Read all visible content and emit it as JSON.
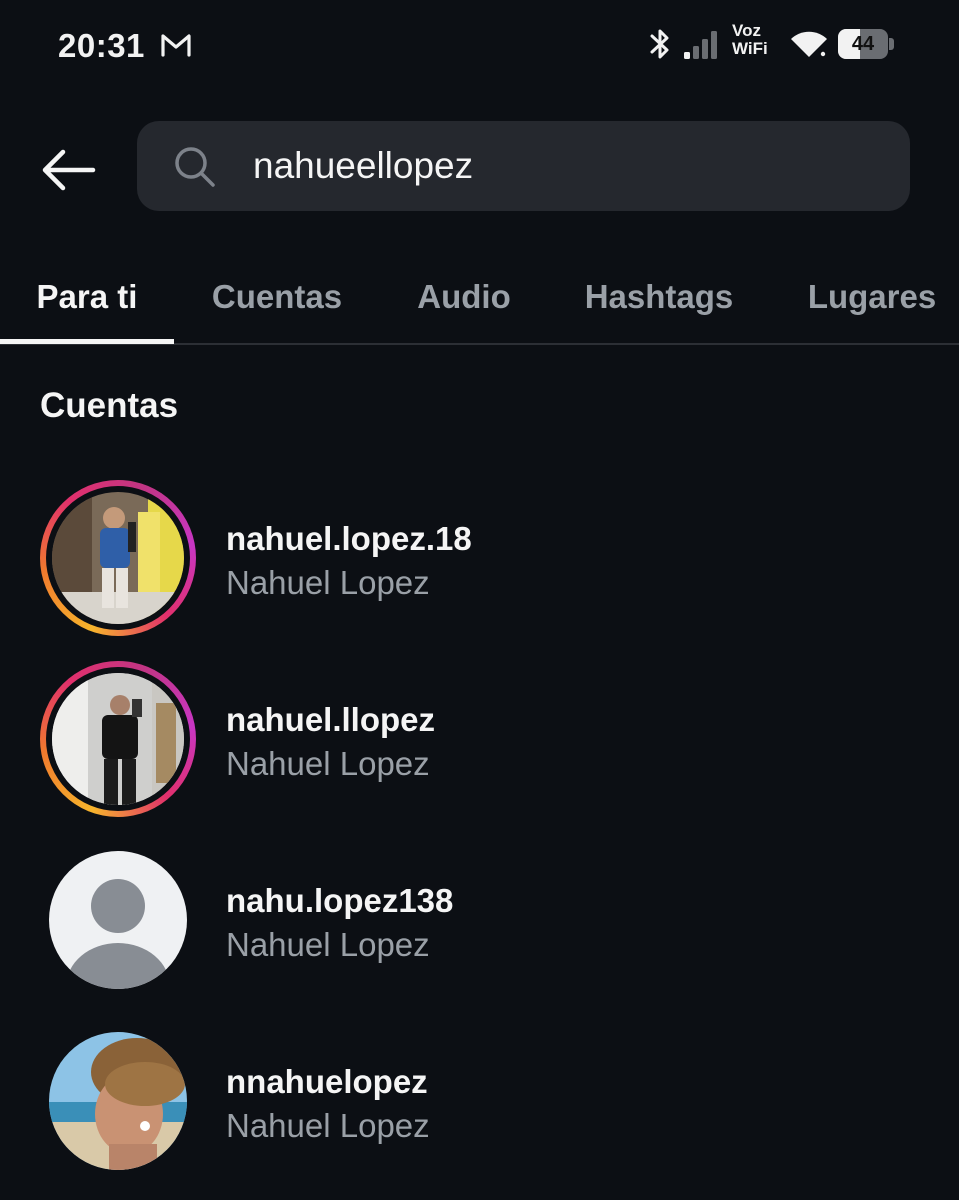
{
  "status_bar": {
    "time": "20:31",
    "voz_line1": "Voz",
    "voz_line2": "WiFi",
    "battery_level": "44",
    "icons": [
      "gmail-icon",
      "bluetooth-icon",
      "cellular-signal-icon",
      "wifi-icon",
      "battery-icon"
    ]
  },
  "header": {
    "back_icon": "arrow-left-icon",
    "search_icon": "search-icon",
    "search_value": "nahueellopez"
  },
  "tabs": [
    {
      "label": "Para ti",
      "active": true
    },
    {
      "label": "Cuentas",
      "active": false
    },
    {
      "label": "Audio",
      "active": false
    },
    {
      "label": "Hashtags",
      "active": false
    },
    {
      "label": "Lugares",
      "active": false
    }
  ],
  "section": {
    "title": "Cuentas"
  },
  "accounts": [
    {
      "username": "nahuel.lopez.18",
      "full_name": "Nahuel Lopez",
      "has_story": true
    },
    {
      "username": "nahuel.llopez",
      "full_name": "Nahuel Lopez",
      "has_story": true
    },
    {
      "username": "nahu.lopez138",
      "full_name": "Nahuel Lopez",
      "has_story": false
    },
    {
      "username": "nnahuelopez",
      "full_name": "Nahuel Lopez",
      "has_story": false
    }
  ],
  "colors": {
    "background": "#0c0f14",
    "search_bg": "#25282e",
    "secondary_text": "#9aa0a7",
    "story_ring_start": "#f7b42c",
    "story_ring_end": "#c836c4"
  }
}
